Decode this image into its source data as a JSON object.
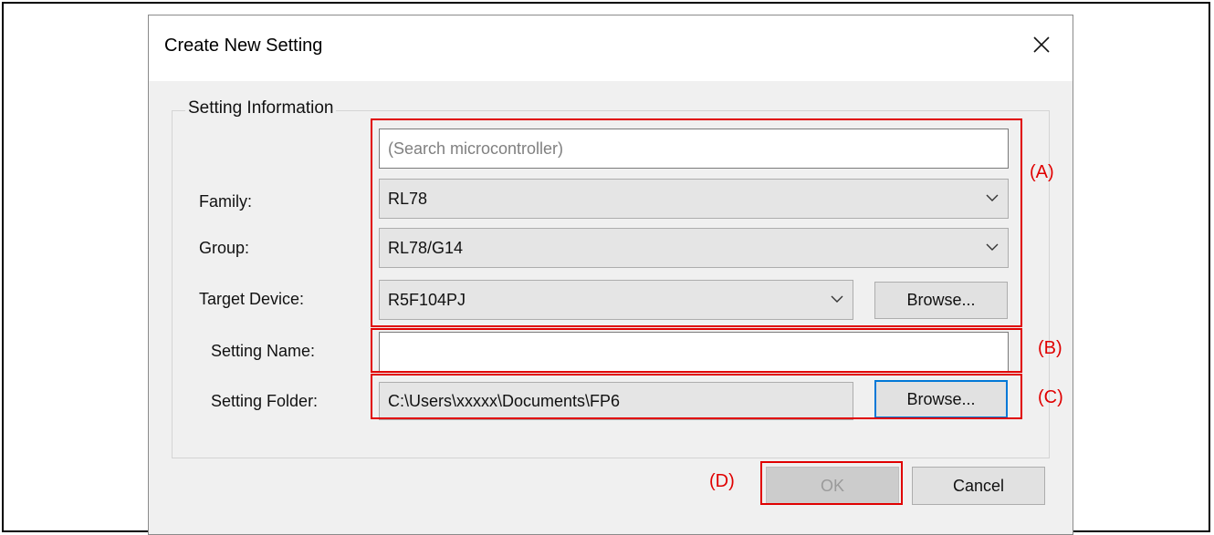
{
  "dialog": {
    "title": "Create New Setting",
    "close_icon": "close-icon"
  },
  "group": {
    "legend": "Setting Information",
    "search_placeholder": "(Search microcontroller)",
    "family_label": "Family:",
    "family_value": "RL78",
    "group_label": "Group:",
    "group_value": "RL78/G14",
    "target_label": "Target Device:",
    "target_value": "R5F104PJ",
    "target_browse": "Browse...",
    "name_label": "Setting Name:",
    "name_value": "",
    "folder_label": "Setting Folder:",
    "folder_value": "C:\\Users\\xxxxx\\Documents\\FP6",
    "folder_browse": "Browse..."
  },
  "buttons": {
    "ok": "OK",
    "cancel": "Cancel"
  },
  "annotations": {
    "a": "(A)",
    "b": "(B)",
    "c": "(C)",
    "d": "(D)",
    "color": "#e00000"
  },
  "colors": {
    "focus_border": "#0078d7",
    "dialog_bg": "#f0f0f0"
  }
}
